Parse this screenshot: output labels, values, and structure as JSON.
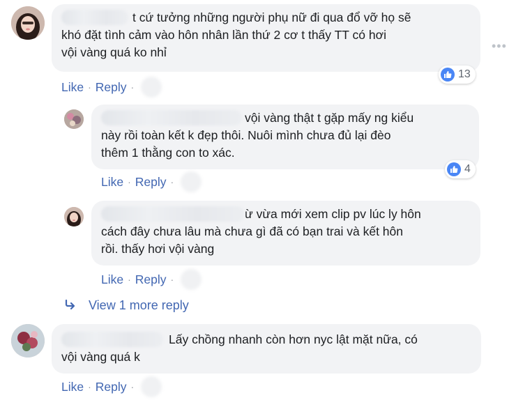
{
  "colors": {
    "link": "#4267b2",
    "bubble": "#f2f3f5",
    "text": "#1c1e21",
    "like_icon": "#4a86f5",
    "meta": "#90949c"
  },
  "icons": {
    "like": "thumbs-up-icon",
    "reply_arrow": "reply-arrow-icon",
    "more": "more-dots-icon"
  },
  "comments": [
    {
      "lines": [
        "t cứ tưởng những người phụ nữ đi qua đổ vỡ họ sẽ",
        "khó đặt tình cảm vào hôn nhân lần thứ 2 cơ t thấy TT có hơi",
        "vội vàng quá ko nhỉ"
      ],
      "like_label": "Like",
      "reply_label": "Reply",
      "reaction_count": "13"
    }
  ],
  "replies": [
    {
      "lines": [
        "vội vàng thật t gặp mấy ng kiểu",
        "này rồi toàn kết k đẹp thôi. Nuôi mình chưa đủ lại đèo",
        "thêm 1 thằng con to xác."
      ],
      "like_label": "Like",
      "reply_label": "Reply",
      "reaction_count": "4"
    },
    {
      "lines": [
        "ừ vừa mới xem clip pv lúc ly hôn",
        "cách đây chưa lâu mà chưa gì đã có bạn trai và kết hôn",
        "rồi. thấy hơi vội vàng"
      ],
      "like_label": "Like",
      "reply_label": "Reply"
    }
  ],
  "view_more_label": "View 1 more reply",
  "comment2": {
    "lines": [
      "Lấy chồng nhanh còn hơn nyc lật mặt nữa, có",
      "vội vàng quá k"
    ],
    "like_label": "Like",
    "reply_label": "Reply"
  }
}
